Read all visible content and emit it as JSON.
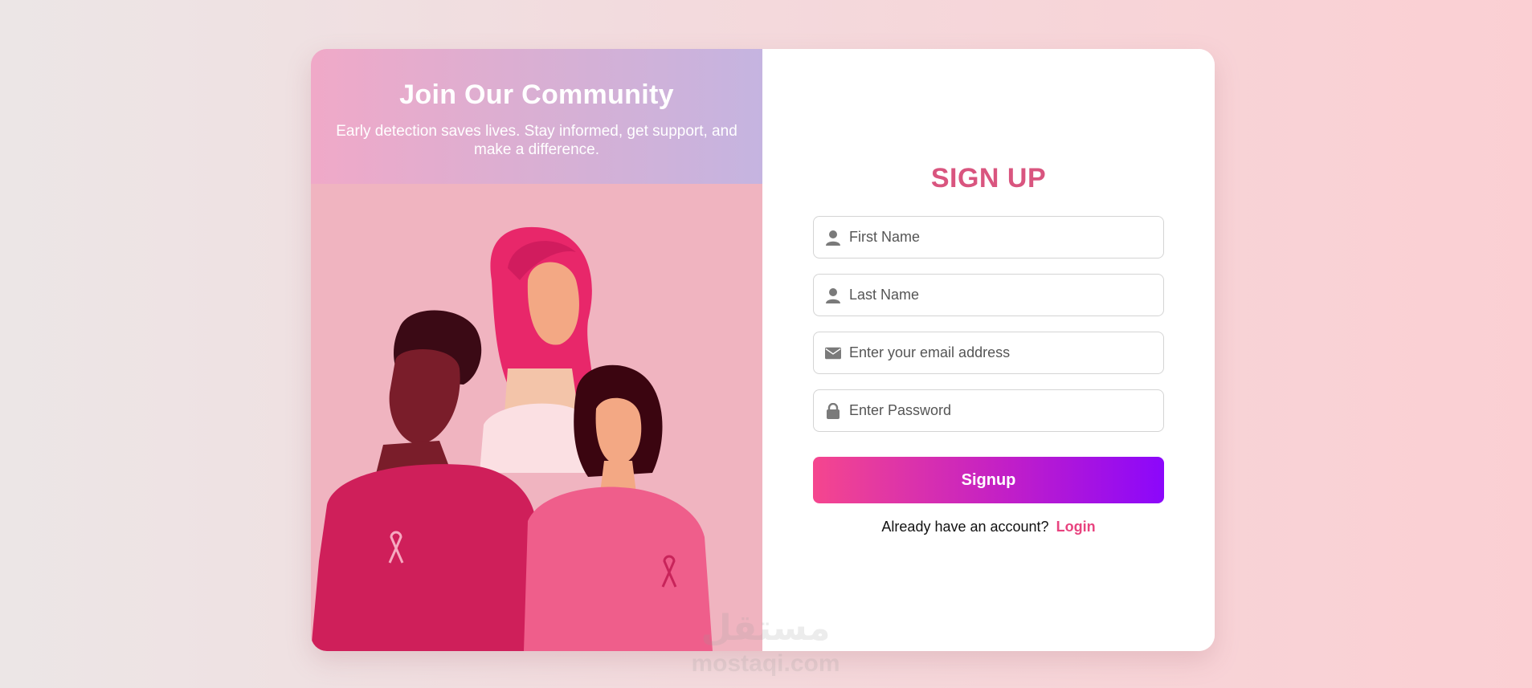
{
  "left_panel": {
    "title": "Join Our Community",
    "subtitle": "Early detection saves lives. Stay informed, get support, and make a difference."
  },
  "form": {
    "title": "SIGN UP",
    "fields": [
      {
        "placeholder": "First Name",
        "value": "",
        "icon": "user-icon"
      },
      {
        "placeholder": "Last Name",
        "value": "",
        "icon": "user-icon"
      },
      {
        "placeholder": "Enter your email address",
        "value": "",
        "icon": "envelope-icon"
      },
      {
        "placeholder": "Enter Password",
        "value": "",
        "icon": "lock-icon"
      }
    ],
    "submit_label": "Signup",
    "login_prompt": "Already have an account?",
    "login_link": "Login"
  },
  "colors": {
    "accent_title": "#d9557f",
    "link": "#e8437f",
    "button_start": "#f5468e",
    "button_end": "#8b07fb"
  },
  "watermark": {
    "arabic": "مستقل",
    "latin": "mostaqi.com"
  }
}
